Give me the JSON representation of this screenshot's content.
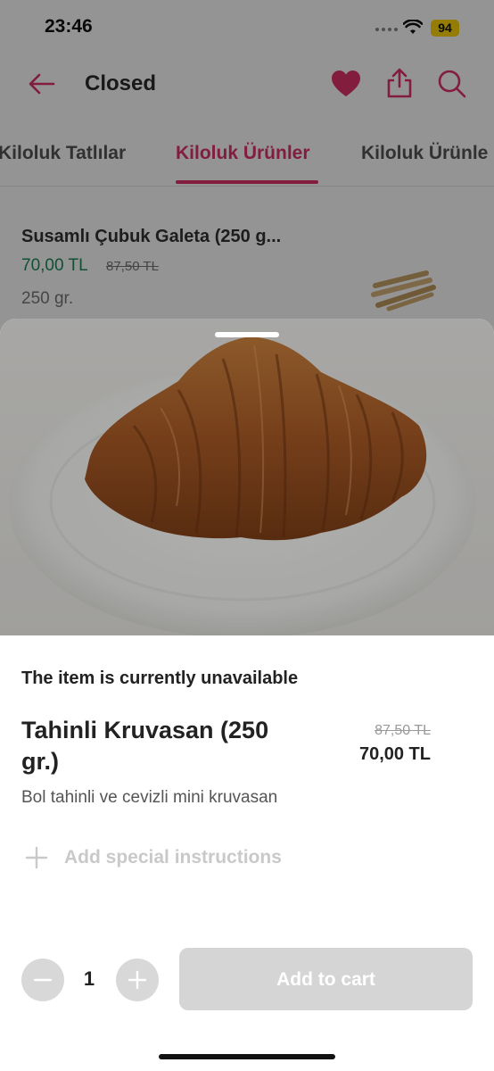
{
  "status_bar": {
    "time": "23:46",
    "battery": "94"
  },
  "header": {
    "title": "Closed"
  },
  "tabs": [
    {
      "label": "Kiloluk Tatlılar",
      "active": false
    },
    {
      "label": "Kiloluk Ürünler",
      "active": true
    },
    {
      "label": "Kiloluk Ürünle",
      "active": false
    }
  ],
  "product_row": {
    "name": "Susamlı Çubuk Galeta (250 g...",
    "price": "70,00 TL",
    "old_price": "87,50 TL",
    "description": "250 gr."
  },
  "item": {
    "unavailable": "The item is currently unavailable",
    "name": "Tahinli Kruvasan (250 gr.)",
    "old_price": "87,50 TL",
    "price": "70,00 TL",
    "description": "Bol tahinli ve cevizli mini kruvasan"
  },
  "instructions": {
    "label": "Add special instructions"
  },
  "cart": {
    "quantity": "1",
    "add_label": "Add to cart"
  },
  "colors": {
    "accent": "#e0326b",
    "price_green": "#1d8a5b",
    "disabled_button": "#d5d5d5"
  },
  "icons": [
    "back-arrow-icon",
    "heart-icon",
    "share-icon",
    "search-icon",
    "plus-icon",
    "minus-icon",
    "wifi-icon"
  ]
}
